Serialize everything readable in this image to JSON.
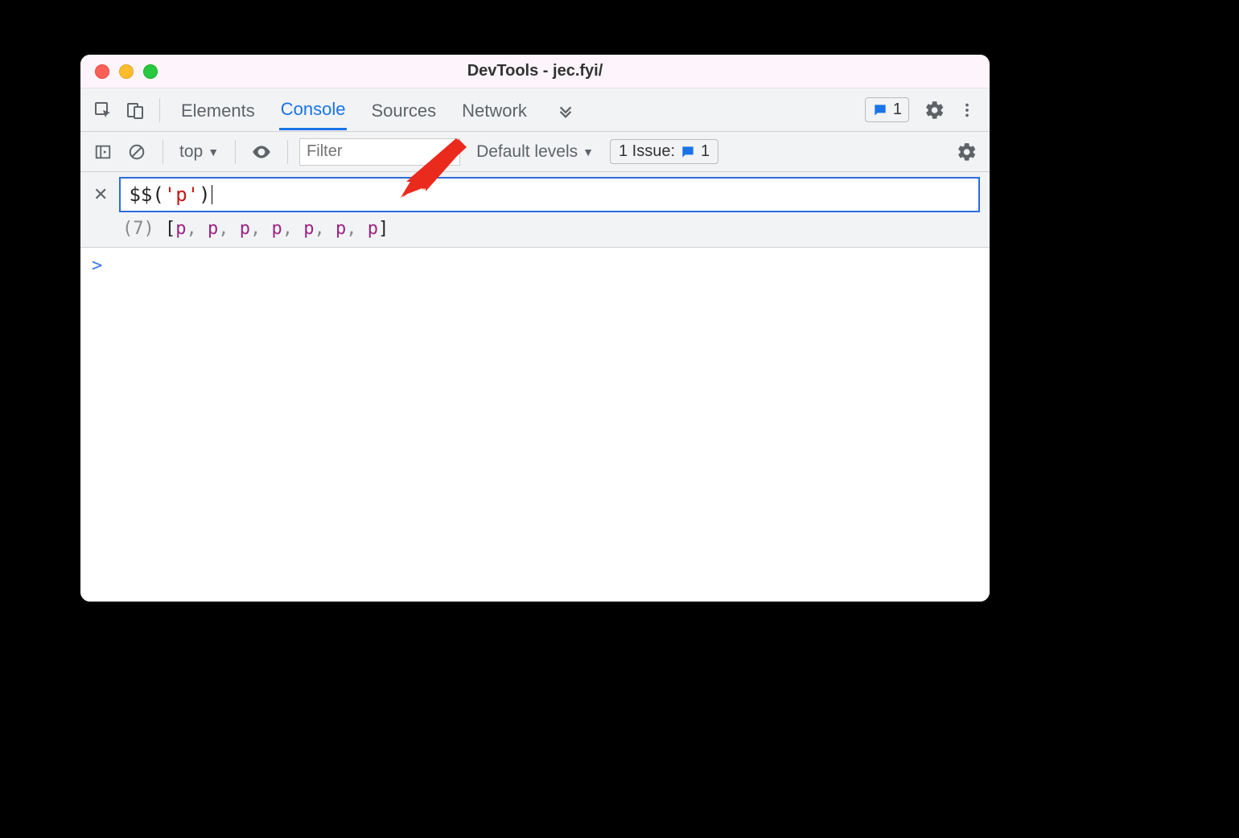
{
  "window": {
    "title": "DevTools - jec.fyi/"
  },
  "toolbar": {
    "tabs": [
      "Elements",
      "Console",
      "Sources",
      "Network"
    ],
    "active_tab_index": 1,
    "messages_badge": "1"
  },
  "subbar": {
    "context": "top",
    "filter_placeholder": "Filter",
    "levels_label": "Default levels",
    "issues_label": "1 Issue:",
    "issues_count": "1"
  },
  "eager": {
    "expression_fn": "$$",
    "expression_arg_quote": "'",
    "expression_arg": "p",
    "preview_count": "(7)",
    "preview_items": [
      "p",
      "p",
      "p",
      "p",
      "p",
      "p",
      "p"
    ]
  },
  "console": {
    "prompt": ">"
  }
}
